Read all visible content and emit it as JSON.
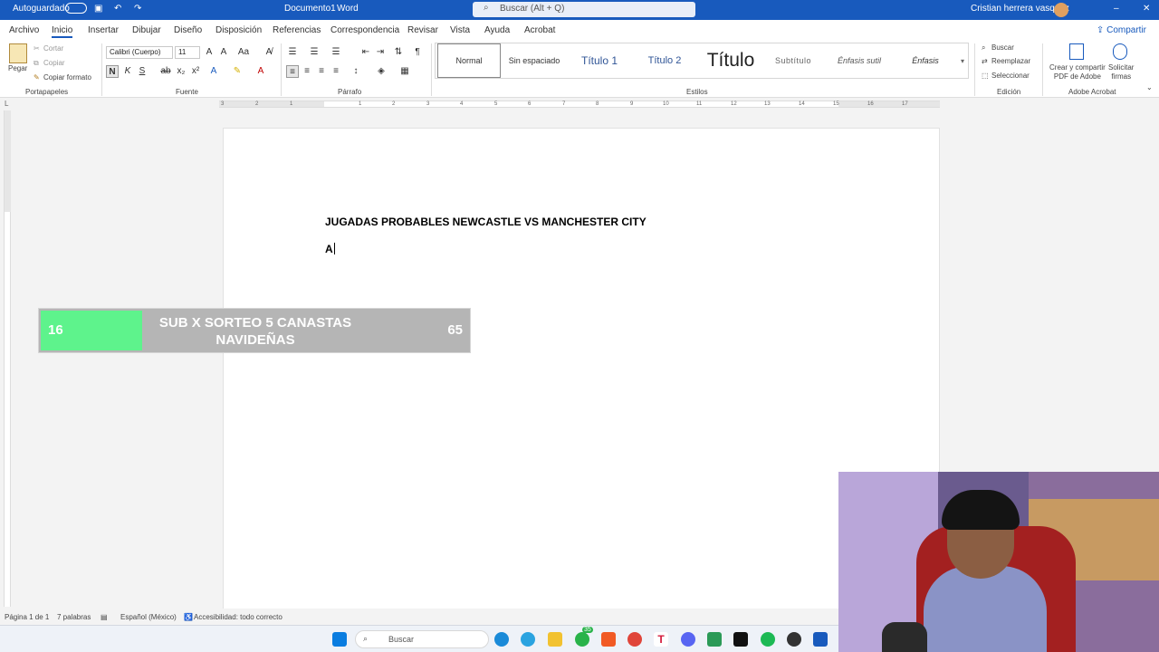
{
  "titlebar": {
    "autosave": "Autoguardado",
    "doc_name": "Documento1",
    "app_name": "Word",
    "search_placeholder": "Buscar (Alt + Q)",
    "user_name": "Cristian herrera vasquez"
  },
  "menu": {
    "items": [
      "Archivo",
      "Inicio",
      "Insertar",
      "Dibujar",
      "Diseño",
      "Disposición",
      "Referencias",
      "Correspondencia",
      "Revisar",
      "Vista",
      "Ayuda",
      "Acrobat"
    ],
    "active": "Inicio",
    "share": "Compartir"
  },
  "ribbon": {
    "clipboard": {
      "paste": "Pegar",
      "cut": "Cortar",
      "copy": "Copiar",
      "format_painter": "Copiar formato",
      "label": "Portapapeles"
    },
    "font": {
      "family": "Calibri (Cuerpo)",
      "size": "11",
      "bold": "N",
      "italic": "K",
      "underline": "S",
      "strike": "ab",
      "sub": "x₂",
      "sup": "x²",
      "label": "Fuente"
    },
    "paragraph": {
      "label": "Párrafo"
    },
    "styles": {
      "items": [
        "Normal",
        "Sin espaciado",
        "Título 1",
        "Título 2",
        "Título",
        "Subtítulo",
        "Énfasis sutil",
        "Énfasis"
      ],
      "label": "Estilos"
    },
    "editing": {
      "find": "Buscar",
      "replace": "Reemplazar",
      "select": "Seleccionar",
      "label": "Edición"
    },
    "acrobat": {
      "create": "Crear y compartir",
      "create2": "PDF de Adobe",
      "sign": "Solicitar",
      "sign2": "firmas",
      "label": "Adobe Acrobat"
    }
  },
  "ruler": {
    "numbers": [
      "3",
      "2",
      "1",
      "1",
      "2",
      "3",
      "4",
      "5",
      "6",
      "7",
      "8",
      "9",
      "10",
      "11",
      "12",
      "13",
      "14",
      "15",
      "16",
      "17"
    ]
  },
  "document": {
    "title": "JUGADAS PROBABLES NEWCASTLE VS MANCHESTER CITY",
    "line2": "A"
  },
  "overlay": {
    "left_number": "16",
    "text_line1": "SUB X SORTEO 5 CANASTAS",
    "text_line2": "NAVIDEÑAS",
    "right_number": "65"
  },
  "statusbar": {
    "page": "Página 1 de 1",
    "words": "7 palabras",
    "language": "Español (México)",
    "accessibility": "Accesibilidad: todo correcto"
  },
  "taskbar": {
    "search": "Buscar",
    "badge": "35"
  },
  "colors": {
    "word_blue": "#185abd",
    "overlay_green": "#5ef38c",
    "overlay_gray": "#b5b5b5"
  }
}
